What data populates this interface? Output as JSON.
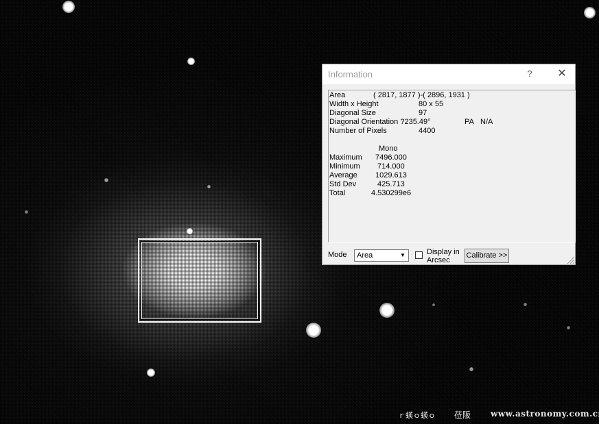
{
  "dialog": {
    "title": "Information",
    "help_glyph": "?",
    "close_glyph": "✕",
    "area_label": "Area",
    "area_value": "( 2817, 1877 )-( 2896, 1931 )",
    "wh_label": "Width x Height",
    "wh_value": "80 x 55",
    "diag_label": "Diagonal Size",
    "diag_value": "97",
    "orient_label": "Diagonal Orientation ?235.49°",
    "pa_label": "PA",
    "pa_value": "N/A",
    "pixels_label": "Number of Pixels",
    "pixels_value": "4400",
    "stats_header": "Mono",
    "stats": [
      {
        "label": "Maximum",
        "value": "7496.000"
      },
      {
        "label": "Minimum",
        "value": "714.000"
      },
      {
        "label": "Average",
        "value": "1029.613"
      },
      {
        "label": "Std Dev",
        "value": "425.713"
      },
      {
        "label": "Total",
        "value": "4.530299e6"
      }
    ],
    "mode_label": "Mode",
    "mode_value": "Area",
    "arcsec_label": "Display in Arcsec",
    "arcsec_checked": false,
    "calibrate_label": "Calibrate >>"
  },
  "watermark": {
    "left": "ｒ蝧ｏ蝧ｏ",
    "middle": "莅阪",
    "right": "www.astronomy.com.cn"
  }
}
